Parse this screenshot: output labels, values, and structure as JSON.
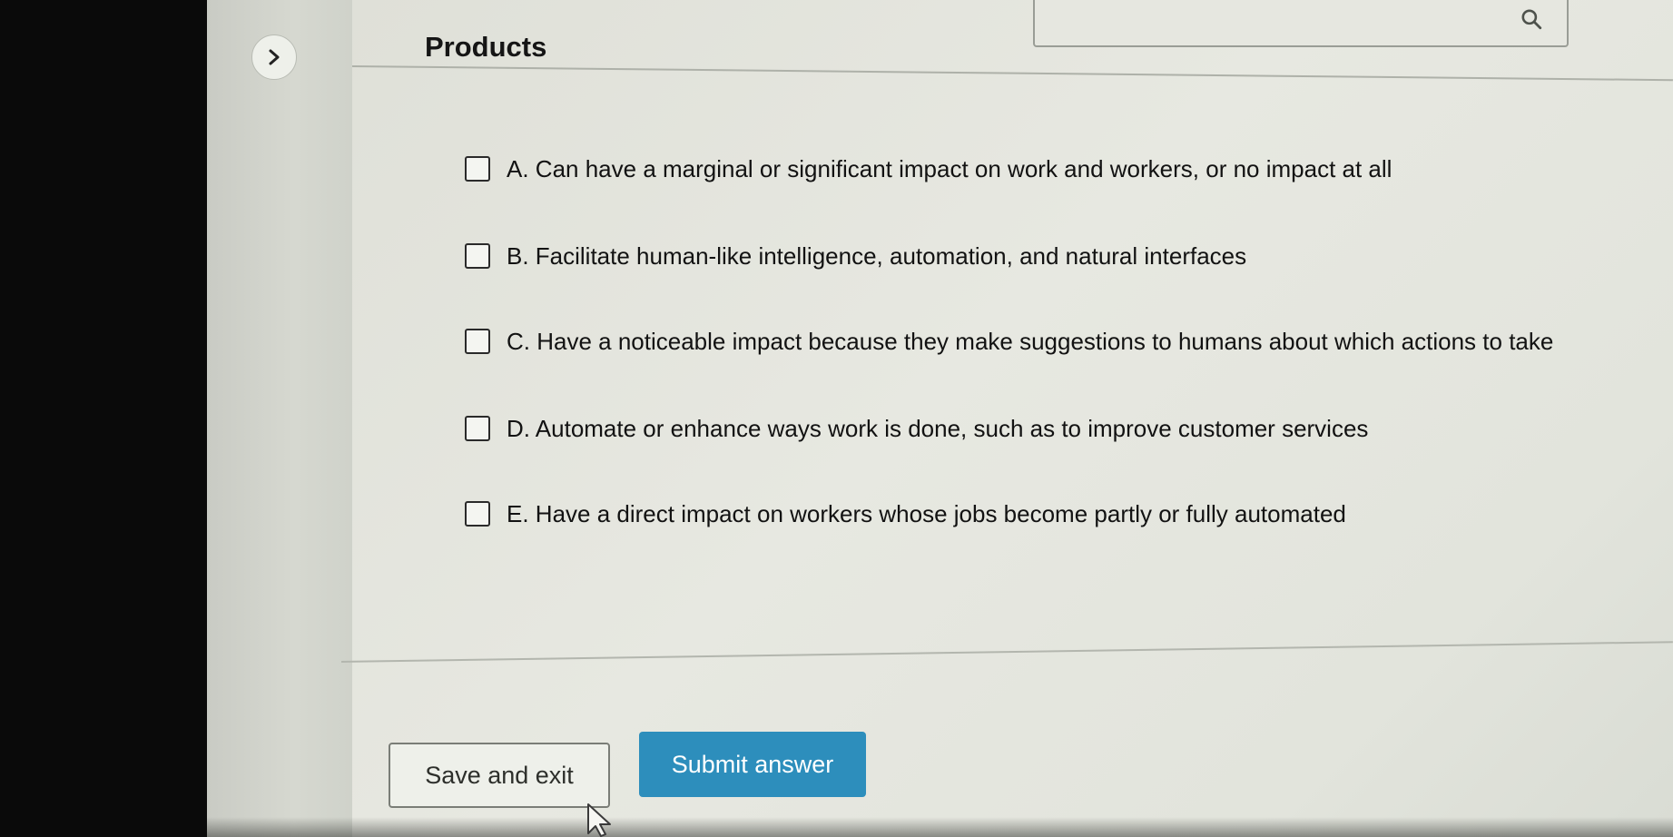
{
  "header": {
    "title": "Products",
    "search_placeholder": ""
  },
  "options": [
    {
      "label": "A. Can have a marginal or significant impact on work and workers, or no impact at all",
      "checked": false
    },
    {
      "label": "B. Facilitate human-like intelligence, automation, and natural interfaces",
      "checked": false
    },
    {
      "label": "C. Have a noticeable impact because they make suggestions to humans about which actions to take",
      "checked": false
    },
    {
      "label": "D. Automate or enhance ways work is done, such as to improve customer services",
      "checked": false
    },
    {
      "label": "E. Have a direct impact on workers whose jobs become partly or fully automated",
      "checked": false
    }
  ],
  "actions": {
    "save_label": "Save and exit",
    "submit_label": "Submit answer"
  },
  "colors": {
    "accent": "#2d8ebc",
    "background": "#e2e4dc"
  },
  "icons": {
    "search": "search-icon",
    "expand": "chevron-right-icon",
    "cursor": "mouse-pointer-icon"
  }
}
